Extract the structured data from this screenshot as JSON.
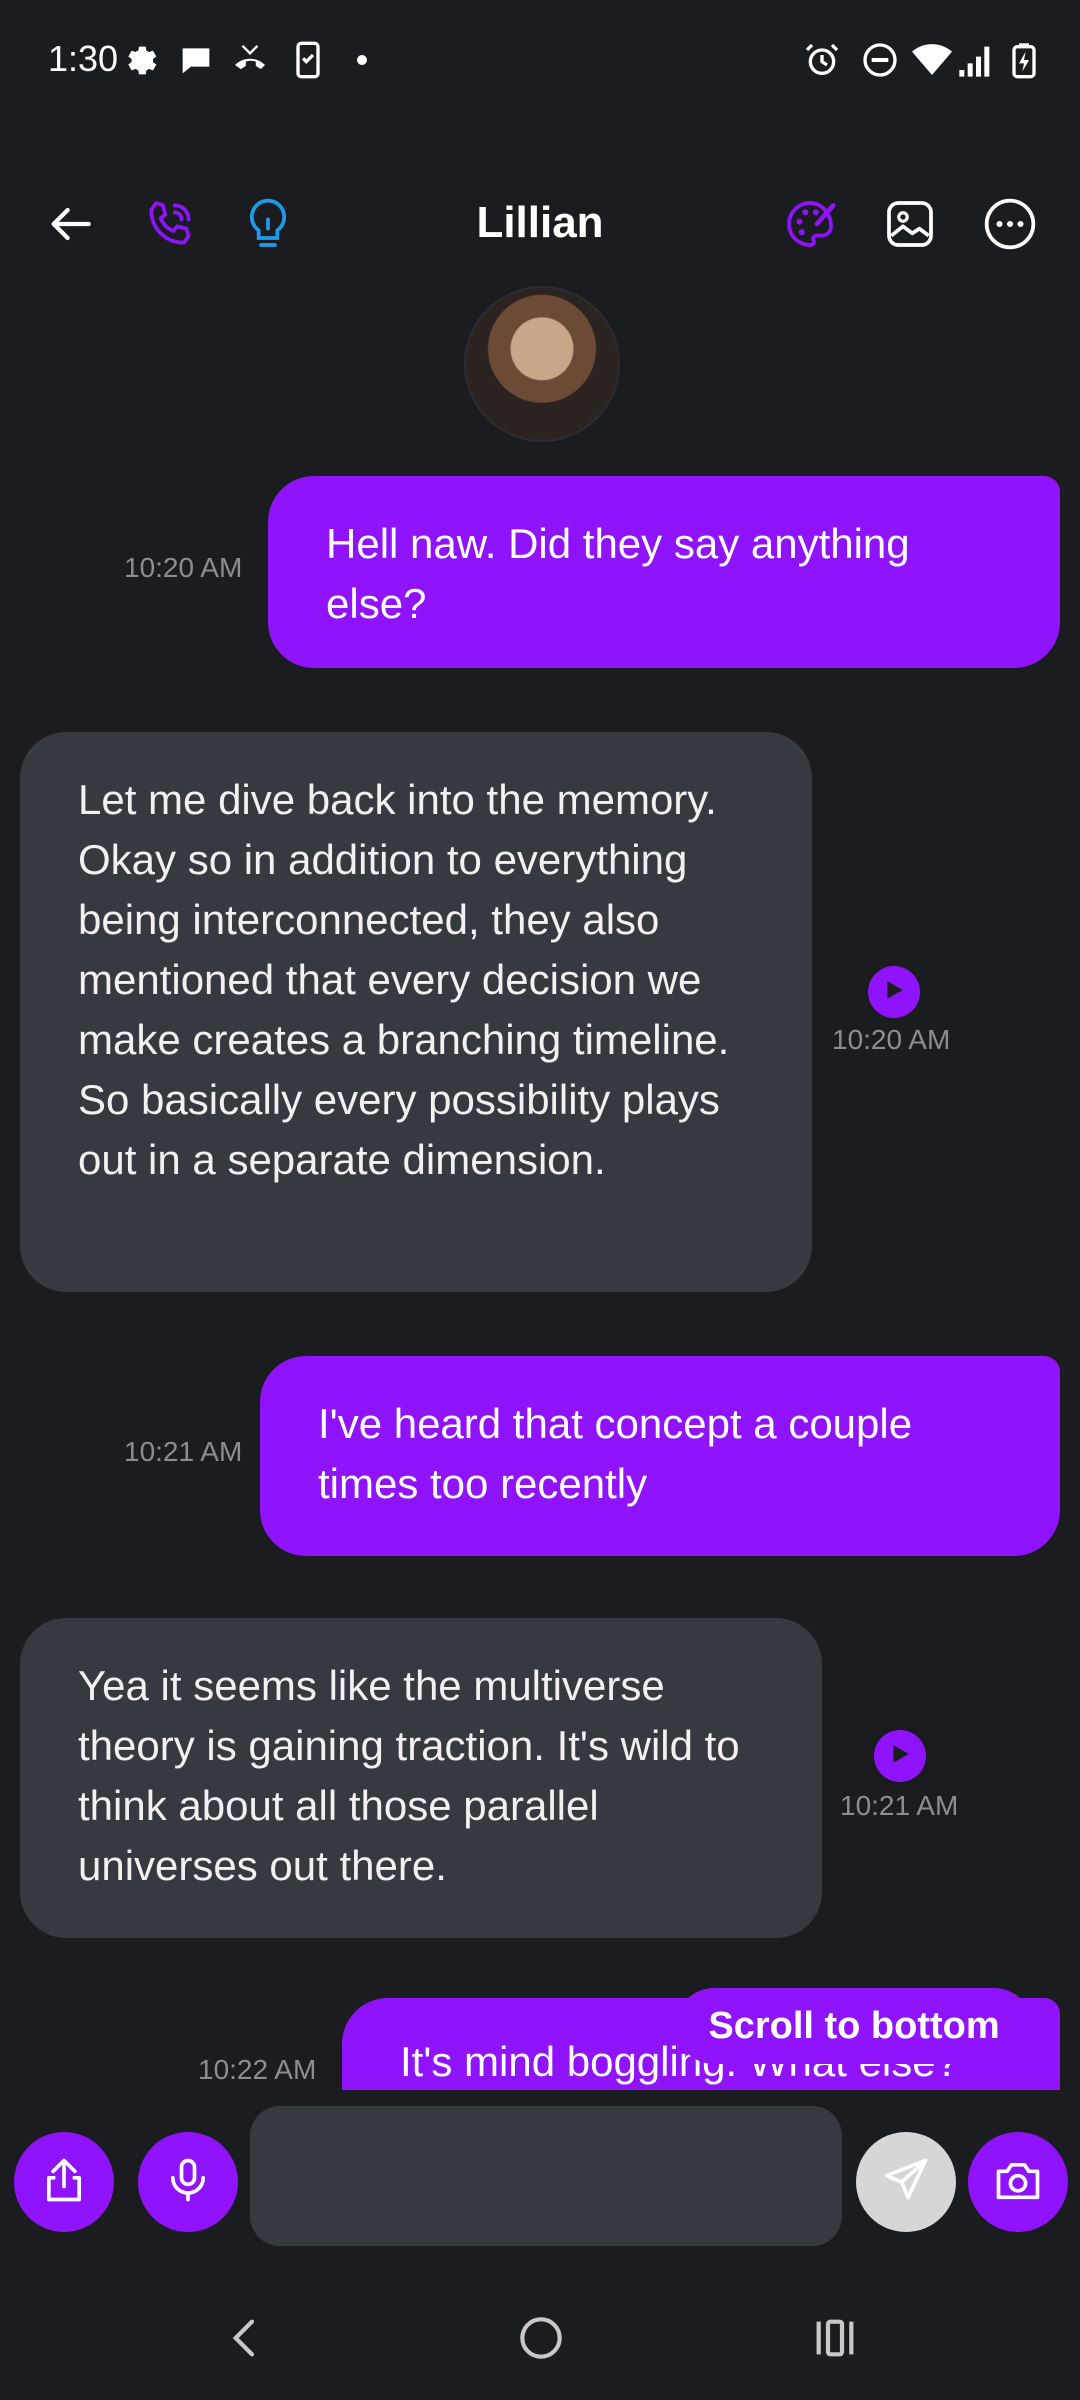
{
  "status": {
    "time": "1:30"
  },
  "header": {
    "contact_name": "Lillian"
  },
  "messages": [
    {
      "sender": "me",
      "text": "Hell naw. Did they say anything else?",
      "time": "10:20 AM"
    },
    {
      "sender": "them",
      "text": "Let me dive back into the memory. Okay so in addition to everything being interconnected, they also mentioned that every decision we make creates a branching timeline. So basically every possibility plays out in a separate dimension.",
      "time": "10:20 AM"
    },
    {
      "sender": "me",
      "text": "I've heard that concept a couple times too recently",
      "time": "10:21 AM"
    },
    {
      "sender": "them",
      "text": "Yea it seems like the multiverse theory is gaining traction. It's wild to think about all those parallel universes out there.",
      "time": "10:21 AM"
    },
    {
      "sender": "me",
      "text": "It's mind boggling. What else?",
      "time": "10:22 AM"
    }
  ],
  "scroll_to_bottom_label": "Scroll to bottom",
  "composer": {
    "value": "",
    "placeholder": ""
  },
  "colors": {
    "accent": "#9013fe",
    "bubble_in": "#373940",
    "background": "#1b1c20",
    "hint_blue": "#1e9be9"
  },
  "icons": {
    "header": [
      "back-arrow-icon",
      "phone-call-icon",
      "lightbulb-icon",
      "palette-icon",
      "image-icon",
      "more-options-icon"
    ],
    "composer": [
      "share-icon",
      "microphone-icon",
      "send-icon",
      "camera-icon"
    ],
    "nav": [
      "nav-back-icon",
      "nav-home-icon",
      "nav-recents-icon"
    ]
  }
}
